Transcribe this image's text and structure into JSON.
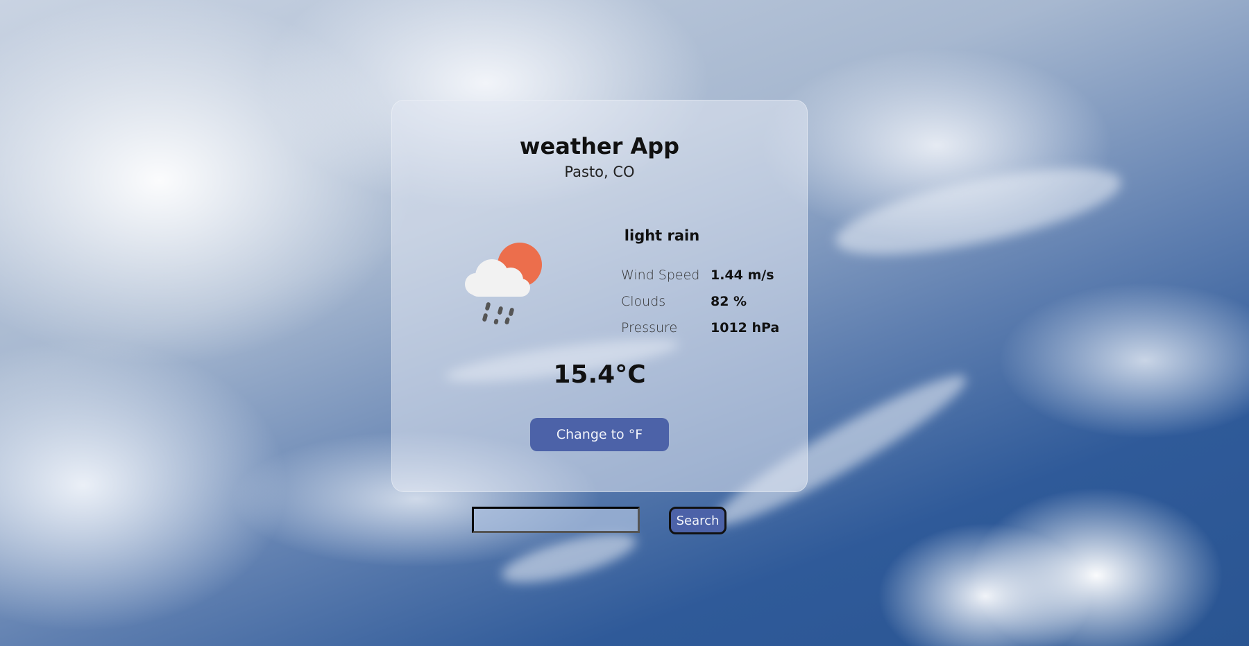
{
  "app": {
    "title": "weather App",
    "location": "Pasto, CO"
  },
  "current": {
    "description": "light rain",
    "icon": "sun-behind-rain-cloud-icon",
    "temperature": "15.4°C",
    "stats": [
      {
        "label": "Wind Speed",
        "value": "1.44 m/s"
      },
      {
        "label": "Clouds",
        "value": "82 %"
      },
      {
        "label": "Pressure",
        "value": "1012 hPa"
      }
    ]
  },
  "controls": {
    "unit_button_label": "Change to °F",
    "search_placeholder": "",
    "search_value": "",
    "search_button_label": "Search"
  },
  "colors": {
    "accent": "#4c62a8",
    "sun": "#ec6e4c",
    "cloud": "#f2f2f2",
    "rain": "#555555"
  }
}
